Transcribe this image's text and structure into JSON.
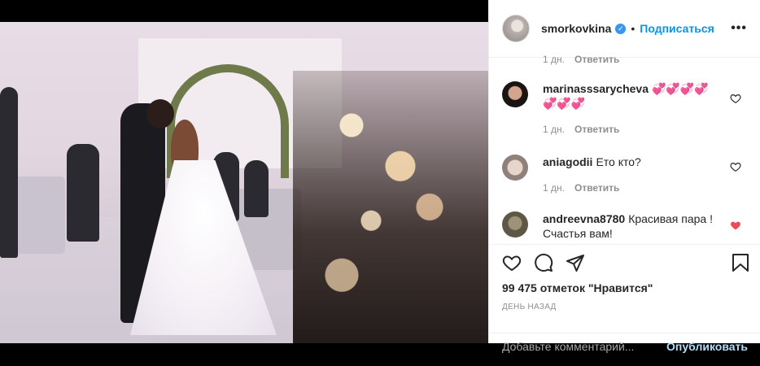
{
  "post": {
    "author": "smorkovkina",
    "follow_label": "Подписаться",
    "separator": "•",
    "more_label": "•••"
  },
  "comments_top_meta": {
    "age": "1 дн.",
    "reply_label": "Ответить"
  },
  "comments": [
    {
      "user": "marinasssarycheva",
      "text": "💞💞💞💞💞💞💞",
      "age": "1 дн.",
      "reply_label": "Ответить",
      "liked": false
    },
    {
      "user": "aniagodii",
      "text": "Ето кто?",
      "age": "1 дн.",
      "reply_label": "Ответить",
      "liked": false
    },
    {
      "user": "andreevna8780",
      "text": "Красивая пара ! Счастья вам!",
      "liked": true
    }
  ],
  "likes_text": "99 475 отметок \"Нравится\"",
  "date_text": "ДЕНЬ НАЗАД",
  "add_comment": {
    "placeholder": "Добавьте комментарий...",
    "post_label": "Опубликовать"
  },
  "colors": {
    "accent": "#0095f6",
    "heart_liked": "#ed4956",
    "muted": "#8e8e8e"
  }
}
